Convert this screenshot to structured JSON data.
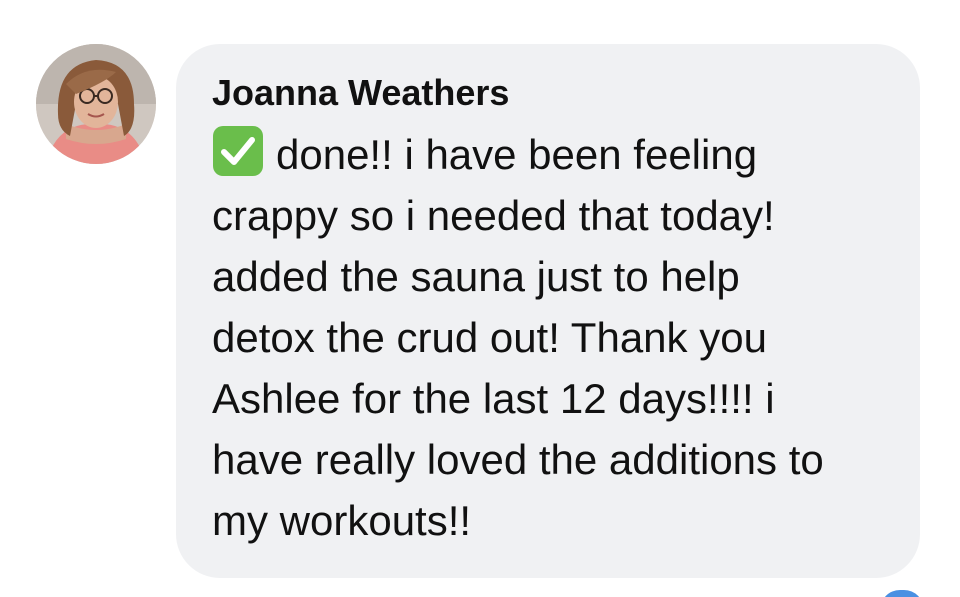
{
  "comment": {
    "author_name": "Joanna Weathers",
    "status_icon": "check-mark-button-icon",
    "lines": [
      "done!! i have been feeling",
      "crappy so i needed that today!",
      "added the sauna just to help",
      "detox the crud out! Thank you",
      "Ashlee for the last 12 days!!!! i",
      "have really loved the additions to",
      "my workouts!!"
    ]
  },
  "colors": {
    "bubble_background": "#f0f1f3",
    "text": "#111111",
    "check_green": "#6abe4b",
    "accent_blue": "#4a90e2"
  }
}
